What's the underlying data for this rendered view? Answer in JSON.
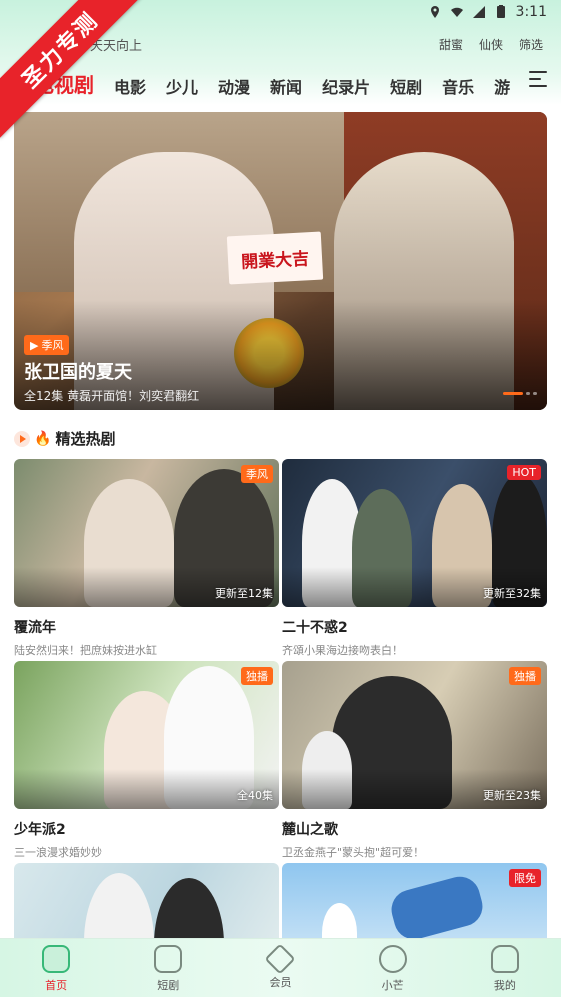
{
  "watermark": "圣力专测",
  "status": {
    "time": "3:11"
  },
  "search": {
    "placeholder": "天天向上"
  },
  "quick_links": [
    "甜蜜",
    "仙侠",
    "筛选"
  ],
  "categories": [
    "电视剧",
    "电影",
    "少儿",
    "动漫",
    "新闻",
    "纪录片",
    "短剧",
    "音乐",
    "游"
  ],
  "active_category": "电视剧",
  "banner": {
    "tag": "季风",
    "sign_text": "開業大吉",
    "title": "张卫国的夏天",
    "desc": "全12集 黄磊开面馆！刘奕君翻红"
  },
  "section": {
    "title": "精选热剧"
  },
  "cards": [
    {
      "name": "覆流年",
      "sub": "陆安然归来！把庶妹按进水缸",
      "badge": "季风",
      "episodes": "更新至12集"
    },
    {
      "name": "二十不惑2",
      "sub": "齐頌小果海边接吻表白！",
      "badge": "HOT",
      "episodes": "更新至32集"
    },
    {
      "name": "少年派2",
      "sub": "三一浪漫求婚妙妙",
      "badge": "独播",
      "episodes": "全40集"
    },
    {
      "name": "麓山之歌",
      "sub": "卫丞金燕子\"蒙头抱\"超可爱！",
      "badge": "独播",
      "episodes": "更新至23集"
    },
    {
      "name": "",
      "sub": "",
      "badge": "",
      "episodes": ""
    },
    {
      "name": "",
      "sub": "",
      "badge": "限免",
      "episodes": ""
    }
  ],
  "bottom_nav": [
    {
      "label": "首页",
      "icon": "home-icon"
    },
    {
      "label": "短剧",
      "icon": "tv-icon"
    },
    {
      "label": "会员",
      "icon": "diamond-icon"
    },
    {
      "label": "小芒",
      "icon": "mango-icon"
    },
    {
      "label": "我的",
      "icon": "profile-icon"
    }
  ],
  "colors": {
    "accent": "#e8232a",
    "tag_orange": "#ff6a1a",
    "brand_green": "#37b878"
  }
}
